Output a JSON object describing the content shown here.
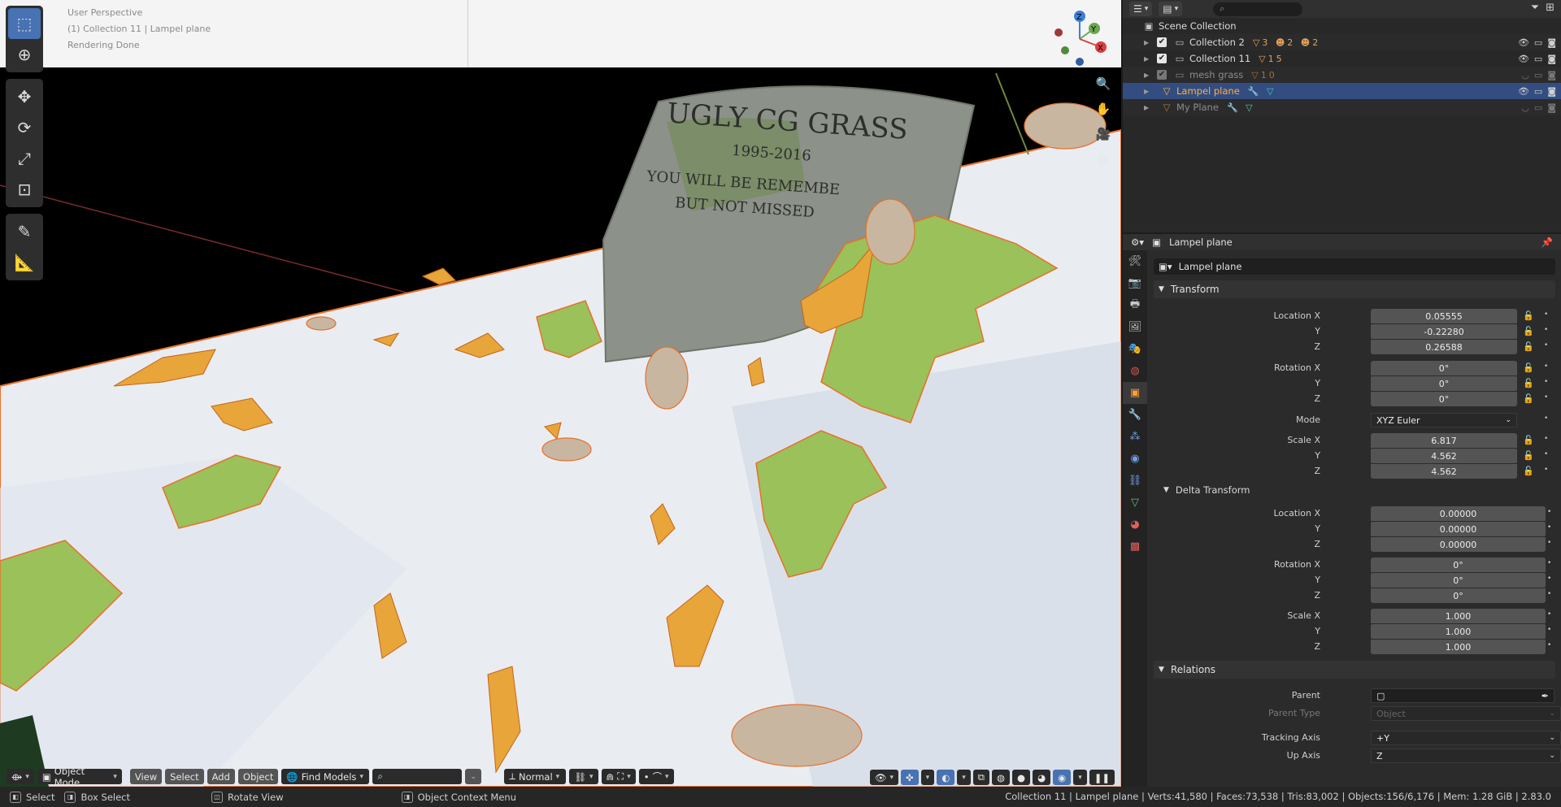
{
  "viewport": {
    "info_lines": [
      "User Perspective",
      "(1) Collection 11 | Lampel plane",
      "Rendering Done"
    ],
    "gizmo_axes": {
      "x": "X",
      "y": "Y",
      "z": "Z"
    },
    "tombstone_text": {
      "line1": "UGLY CG GRASS",
      "line2": "1995-2016",
      "line3": "YOU WILL BE REMEMBE",
      "line4": "BUT NOT MISSED"
    },
    "bottom_bar": {
      "mode": "Object Mode",
      "menus": [
        "View",
        "Select",
        "Add",
        "Object"
      ],
      "find_models": "Find Models",
      "pivot": "Normal"
    }
  },
  "outliner": {
    "root": "Scene Collection",
    "rows": [
      {
        "name": "Collection 2",
        "badges": "▽3 ☻2 ☻2",
        "checked": true
      },
      {
        "name": "Collection 11",
        "badges": "▽15",
        "checked": true
      },
      {
        "name": "mesh grass",
        "badges": "▽10",
        "checked": true
      },
      {
        "name": "Lampel plane",
        "badges": "🔧 ▽",
        "selected": true
      },
      {
        "name": "My Plane",
        "badges": "🔧 ▽"
      }
    ]
  },
  "properties": {
    "header_object": "Lampel plane",
    "object_name": "Lampel plane",
    "transform": {
      "title": "Transform",
      "location": {
        "label": "Location X",
        "x": "0.05555",
        "y": "-0.22280",
        "z": "0.26588"
      },
      "rotation": {
        "label": "Rotation X",
        "x": "0°",
        "y": "0°",
        "z": "0°"
      },
      "mode_label": "Mode",
      "mode_value": "XYZ Euler",
      "scale": {
        "label": "Scale X",
        "x": "6.817",
        "y": "4.562",
        "z": "4.562"
      },
      "y_label": "Y",
      "z_label": "Z"
    },
    "delta": {
      "title": "Delta Transform",
      "location": {
        "label": "Location X",
        "x": "0.00000",
        "y": "0.00000",
        "z": "0.00000"
      },
      "rotation": {
        "label": "Rotation X",
        "x": "0°",
        "y": "0°",
        "z": "0°"
      },
      "scale": {
        "label": "Scale X",
        "x": "1.000",
        "y": "1.000",
        "z": "1.000"
      }
    },
    "relations": {
      "title": "Relations",
      "parent_label": "Parent",
      "parent_type_label": "Parent Type",
      "parent_type_value": "Object",
      "tracking_axis_label": "Tracking Axis",
      "tracking_axis_value": "+Y",
      "up_axis_label": "Up Axis",
      "up_axis_value": "Z"
    }
  },
  "statusbar": {
    "select": "Select",
    "box_select": "Box Select",
    "rotate_view": "Rotate View",
    "context_menu": "Object Context Menu",
    "stats": "Collection 11 | Lampel plane | Verts:41,580 | Faces:73,538 | Tris:83,002 | Objects:156/6,176 | Mem: 1.28 GiB | 2.83.0"
  },
  "colors": {
    "accent": "#4772b3",
    "selection_orange": "#ffaf40",
    "outline_orange": "#e8702a"
  }
}
